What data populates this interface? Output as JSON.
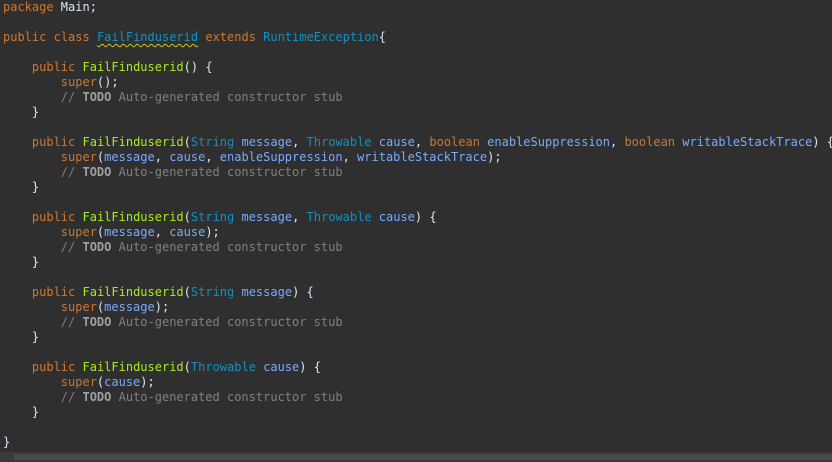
{
  "editor": {
    "colors": {
      "background": "#2f2f2f",
      "keyword": "#cc7832",
      "class_name": "#1290c3",
      "type": "#1290c3",
      "method": "#a7ec21",
      "param": "#79abff",
      "plain": "#d9e8f7",
      "comment": "#808080",
      "todo": "#a0a0a0",
      "warning_underline": "#c8c820"
    },
    "lines": [
      [
        {
          "t": "package",
          "c": "keyword"
        },
        {
          "t": " Main;",
          "c": "plain"
        }
      ],
      [],
      [
        {
          "t": "public",
          "c": "keyword"
        },
        {
          "t": " ",
          "c": "plain"
        },
        {
          "t": "class",
          "c": "keyword"
        },
        {
          "t": " ",
          "c": "plain"
        },
        {
          "t": "FailFinduserid",
          "c": "class_name",
          "u": true
        },
        {
          "t": " ",
          "c": "plain"
        },
        {
          "t": "extends",
          "c": "keyword"
        },
        {
          "t": " ",
          "c": "plain"
        },
        {
          "t": "RuntimeException",
          "c": "type"
        },
        {
          "t": "{",
          "c": "plain"
        }
      ],
      [],
      [
        {
          "t": "    ",
          "c": "plain"
        },
        {
          "t": "public",
          "c": "keyword"
        },
        {
          "t": " ",
          "c": "plain"
        },
        {
          "t": "FailFinduserid",
          "c": "method"
        },
        {
          "t": "() {",
          "c": "plain"
        }
      ],
      [
        {
          "t": "        ",
          "c": "plain"
        },
        {
          "t": "super",
          "c": "keyword"
        },
        {
          "t": "();",
          "c": "plain"
        }
      ],
      [
        {
          "t": "        // ",
          "c": "comment"
        },
        {
          "t": "TODO",
          "c": "todo"
        },
        {
          "t": " Auto-generated constructor stub",
          "c": "comment"
        }
      ],
      [
        {
          "t": "    }",
          "c": "plain"
        }
      ],
      [],
      [
        {
          "t": "    ",
          "c": "plain"
        },
        {
          "t": "public",
          "c": "keyword"
        },
        {
          "t": " ",
          "c": "plain"
        },
        {
          "t": "FailFinduserid",
          "c": "method"
        },
        {
          "t": "(",
          "c": "plain"
        },
        {
          "t": "String",
          "c": "type"
        },
        {
          "t": " ",
          "c": "plain"
        },
        {
          "t": "message",
          "c": "param"
        },
        {
          "t": ", ",
          "c": "plain"
        },
        {
          "t": "Throwable",
          "c": "type"
        },
        {
          "t": " ",
          "c": "plain"
        },
        {
          "t": "cause",
          "c": "param"
        },
        {
          "t": ", ",
          "c": "plain"
        },
        {
          "t": "boolean",
          "c": "keyword"
        },
        {
          "t": " ",
          "c": "plain"
        },
        {
          "t": "enableSuppression",
          "c": "param"
        },
        {
          "t": ", ",
          "c": "plain"
        },
        {
          "t": "boolean",
          "c": "keyword"
        },
        {
          "t": " ",
          "c": "plain"
        },
        {
          "t": "writableStackTrace",
          "c": "param"
        },
        {
          "t": ") {",
          "c": "plain"
        }
      ],
      [
        {
          "t": "        ",
          "c": "plain"
        },
        {
          "t": "super",
          "c": "keyword"
        },
        {
          "t": "(",
          "c": "plain"
        },
        {
          "t": "message",
          "c": "param"
        },
        {
          "t": ", ",
          "c": "plain"
        },
        {
          "t": "cause",
          "c": "param"
        },
        {
          "t": ", ",
          "c": "plain"
        },
        {
          "t": "enableSuppression",
          "c": "param"
        },
        {
          "t": ", ",
          "c": "plain"
        },
        {
          "t": "writableStackTrace",
          "c": "param"
        },
        {
          "t": ");",
          "c": "plain"
        }
      ],
      [
        {
          "t": "        // ",
          "c": "comment"
        },
        {
          "t": "TODO",
          "c": "todo"
        },
        {
          "t": " Auto-generated constructor stub",
          "c": "comment"
        }
      ],
      [
        {
          "t": "    }",
          "c": "plain"
        }
      ],
      [],
      [
        {
          "t": "    ",
          "c": "plain"
        },
        {
          "t": "public",
          "c": "keyword"
        },
        {
          "t": " ",
          "c": "plain"
        },
        {
          "t": "FailFinduserid",
          "c": "method"
        },
        {
          "t": "(",
          "c": "plain"
        },
        {
          "t": "String",
          "c": "type"
        },
        {
          "t": " ",
          "c": "plain"
        },
        {
          "t": "message",
          "c": "param"
        },
        {
          "t": ", ",
          "c": "plain"
        },
        {
          "t": "Throwable",
          "c": "type"
        },
        {
          "t": " ",
          "c": "plain"
        },
        {
          "t": "cause",
          "c": "param"
        },
        {
          "t": ") {",
          "c": "plain"
        }
      ],
      [
        {
          "t": "        ",
          "c": "plain"
        },
        {
          "t": "super",
          "c": "keyword"
        },
        {
          "t": "(",
          "c": "plain"
        },
        {
          "t": "message",
          "c": "param"
        },
        {
          "t": ", ",
          "c": "plain"
        },
        {
          "t": "cause",
          "c": "param"
        },
        {
          "t": ");",
          "c": "plain"
        }
      ],
      [
        {
          "t": "        // ",
          "c": "comment"
        },
        {
          "t": "TODO",
          "c": "todo"
        },
        {
          "t": " Auto-generated constructor stub",
          "c": "comment"
        }
      ],
      [
        {
          "t": "    }",
          "c": "plain"
        }
      ],
      [],
      [
        {
          "t": "    ",
          "c": "plain"
        },
        {
          "t": "public",
          "c": "keyword"
        },
        {
          "t": " ",
          "c": "plain"
        },
        {
          "t": "FailFinduserid",
          "c": "method"
        },
        {
          "t": "(",
          "c": "plain"
        },
        {
          "t": "String",
          "c": "type"
        },
        {
          "t": " ",
          "c": "plain"
        },
        {
          "t": "message",
          "c": "param"
        },
        {
          "t": ") {",
          "c": "plain"
        }
      ],
      [
        {
          "t": "        ",
          "c": "plain"
        },
        {
          "t": "super",
          "c": "keyword"
        },
        {
          "t": "(",
          "c": "plain"
        },
        {
          "t": "message",
          "c": "param"
        },
        {
          "t": ");",
          "c": "plain"
        }
      ],
      [
        {
          "t": "        // ",
          "c": "comment"
        },
        {
          "t": "TODO",
          "c": "todo"
        },
        {
          "t": " Auto-generated constructor stub",
          "c": "comment"
        }
      ],
      [
        {
          "t": "    }",
          "c": "plain"
        }
      ],
      [],
      [
        {
          "t": "    ",
          "c": "plain"
        },
        {
          "t": "public",
          "c": "keyword"
        },
        {
          "t": " ",
          "c": "plain"
        },
        {
          "t": "FailFinduserid",
          "c": "method"
        },
        {
          "t": "(",
          "c": "plain"
        },
        {
          "t": "Throwable",
          "c": "type"
        },
        {
          "t": " ",
          "c": "plain"
        },
        {
          "t": "cause",
          "c": "param"
        },
        {
          "t": ") {",
          "c": "plain"
        }
      ],
      [
        {
          "t": "        ",
          "c": "plain"
        },
        {
          "t": "super",
          "c": "keyword"
        },
        {
          "t": "(",
          "c": "plain"
        },
        {
          "t": "cause",
          "c": "param"
        },
        {
          "t": ");",
          "c": "plain"
        }
      ],
      [
        {
          "t": "        // ",
          "c": "comment"
        },
        {
          "t": "TODO",
          "c": "todo"
        },
        {
          "t": " Auto-generated constructor stub",
          "c": "comment"
        }
      ],
      [
        {
          "t": "    }",
          "c": "plain"
        }
      ],
      [],
      [
        {
          "t": "}",
          "c": "plain"
        }
      ]
    ]
  }
}
